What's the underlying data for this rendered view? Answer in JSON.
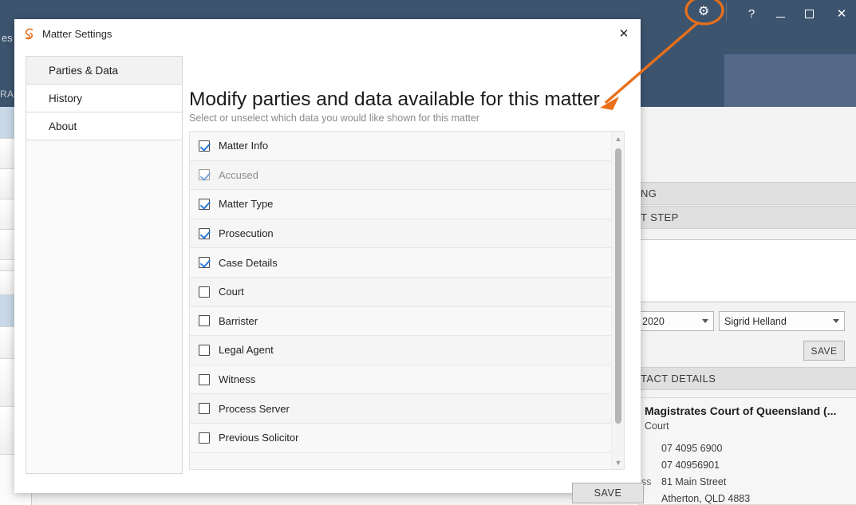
{
  "background": {
    "window_controls": {
      "settings_gear_label": "⚙",
      "help_label": "?",
      "minimize_label": "",
      "maximize_label": "",
      "close_label": "✕"
    },
    "left_fragments": [
      {
        "text": "es C"
      },
      {
        "text": "RAC"
      }
    ],
    "sections": [
      {
        "label": "NG"
      },
      {
        "label": "T STEP"
      },
      {
        "label": "TACT DETAILS"
      }
    ],
    "date_combo_value": "2020",
    "person_combo_value": "Sigrid Helland",
    "save_label": "SAVE",
    "contact": {
      "name": "Magistrates Court of Queensland (...",
      "type": "Court",
      "phone_primary": "07 4095 6900",
      "phone_secondary": "07 40956901",
      "address_label": "ss",
      "address_line1": "81 Main Street",
      "address_line2": "Atherton, QLD 4883"
    }
  },
  "dialog": {
    "title": "Matter Settings",
    "logo_glyph": "◎",
    "close_label": "✕",
    "sidebar": {
      "items": [
        {
          "label": "Parties & Data",
          "active": true
        },
        {
          "label": "History",
          "active": false
        },
        {
          "label": "About",
          "active": false
        }
      ]
    },
    "main": {
      "heading": "Modify parties and data available for this matter",
      "subheading": "Select or unselect which data you would like shown for this matter",
      "options": [
        {
          "label": "Matter Info",
          "checked": true,
          "disabled": false
        },
        {
          "label": "Accused",
          "checked": true,
          "disabled": true
        },
        {
          "label": "Matter Type",
          "checked": true,
          "disabled": false
        },
        {
          "label": "Prosecution",
          "checked": true,
          "disabled": false
        },
        {
          "label": "Case Details",
          "checked": true,
          "disabled": false
        },
        {
          "label": "Court",
          "checked": false,
          "disabled": false
        },
        {
          "label": "Barrister",
          "checked": false,
          "disabled": false
        },
        {
          "label": "Legal Agent",
          "checked": false,
          "disabled": false
        },
        {
          "label": "Witness",
          "checked": false,
          "disabled": false
        },
        {
          "label": "Process Server",
          "checked": false,
          "disabled": false
        },
        {
          "label": "Previous Solicitor",
          "checked": false,
          "disabled": false
        }
      ],
      "scroll_up_glyph": "▲",
      "scroll_down_glyph": "▼"
    },
    "save_label": "SAVE"
  },
  "annotation": {
    "type": "ellipse-with-arrow",
    "target": "settings-gear-button",
    "color": "#e8701a"
  }
}
